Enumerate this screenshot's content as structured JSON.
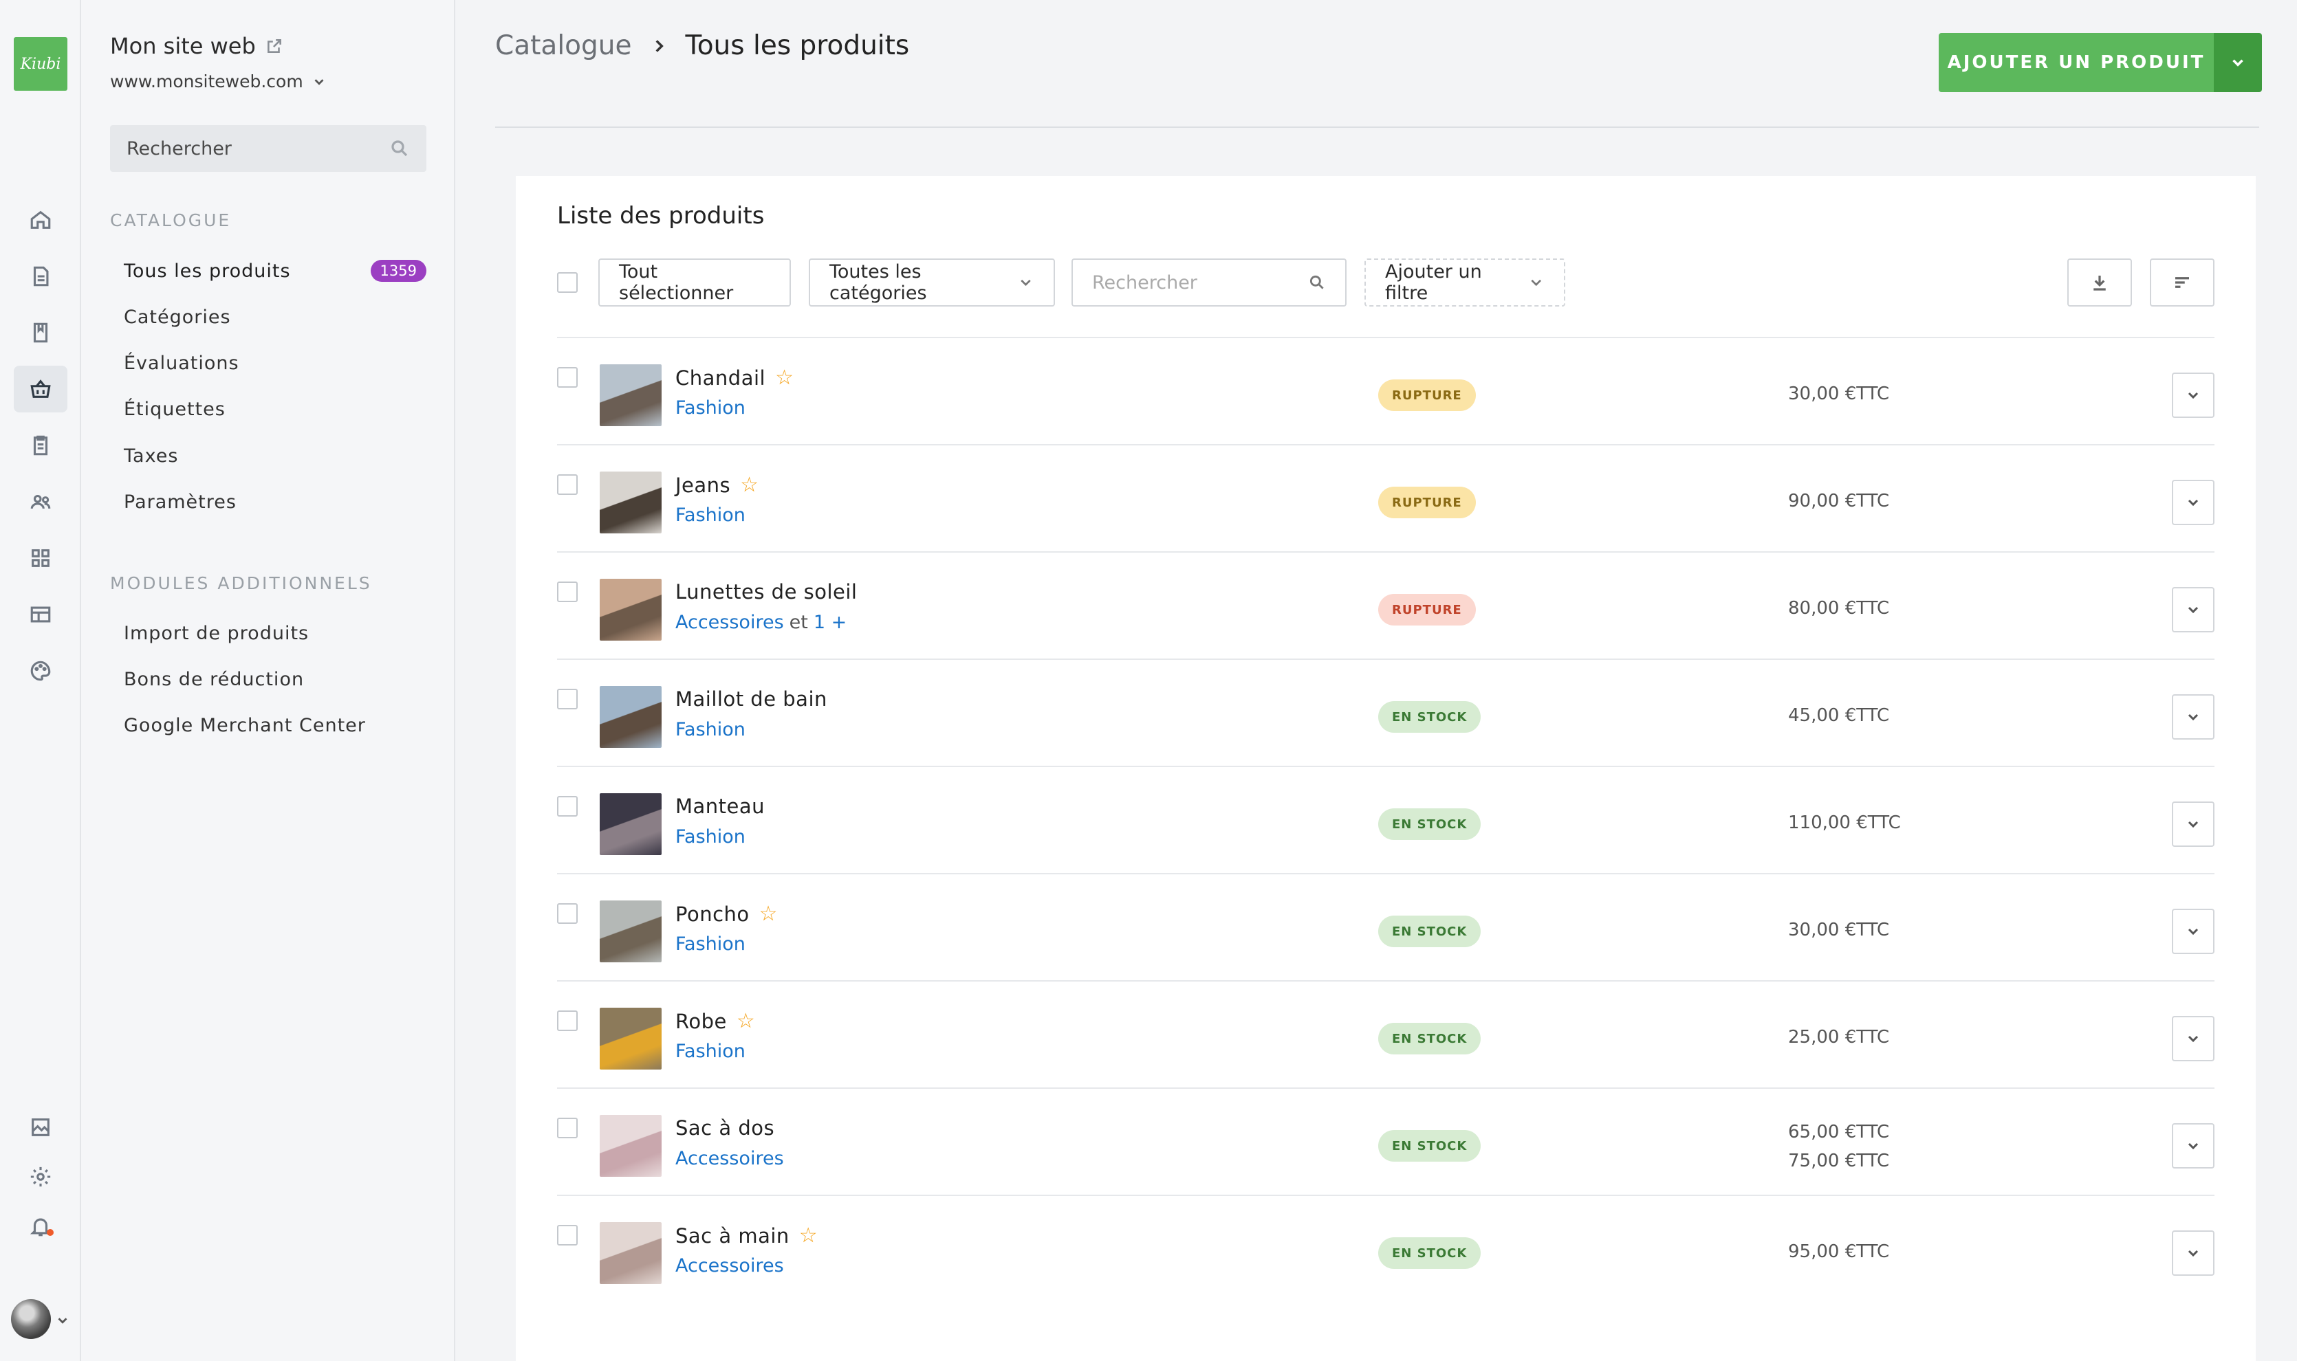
{
  "app": {
    "logo_text": "Kiubi",
    "site_name": "Mon site web",
    "site_url": "www.monsiteweb.com"
  },
  "rail_icons": [
    "home-icon",
    "page-icon",
    "blog-icon",
    "basket-icon",
    "orders-icon",
    "users-icon",
    "modules-icon",
    "layout-icon",
    "palette-icon",
    "media-icon",
    "gear-icon",
    "bell-icon"
  ],
  "sidebar": {
    "search_placeholder": "Rechercher",
    "catalogue_title": "CATALOGUE",
    "catalogue_items": [
      {
        "label": "Tous les produits",
        "badge": "1359"
      },
      {
        "label": "Catégories"
      },
      {
        "label": "Évaluations"
      },
      {
        "label": "Étiquettes"
      },
      {
        "label": "Taxes"
      },
      {
        "label": "Paramètres"
      }
    ],
    "modules_title": "MODULES ADDITIONNELS",
    "modules_items": [
      {
        "label": "Import de produits"
      },
      {
        "label": "Bons de réduction"
      },
      {
        "label": "Google Merchant Center"
      }
    ]
  },
  "header": {
    "breadcrumb_parent": "Catalogue",
    "breadcrumb_current": "Tous les produits",
    "add_button": "AJOUTER UN PRODUIT"
  },
  "list": {
    "title": "Liste des produits",
    "select_all": "Tout sélectionner",
    "category_filter": "Toutes les catégories",
    "search_placeholder": "Rechercher",
    "add_filter": "Ajouter un filtre"
  },
  "colors": {
    "accent_green": "#5cb85c",
    "badge_purple": "#9b3fc2",
    "link_blue": "#1a73c9",
    "star": "#f5a623"
  },
  "products": [
    {
      "name": "Chandail",
      "star": true,
      "category": "Fashion",
      "extra": "",
      "status": "RUPTURE",
      "status_type": "rupture",
      "prices": [
        "30,00 €TTC"
      ]
    },
    {
      "name": "Jeans",
      "star": true,
      "category": "Fashion",
      "extra": "",
      "status": "RUPTURE",
      "status_type": "rupture",
      "prices": [
        "90,00 €TTC"
      ]
    },
    {
      "name": "Lunettes de soleil",
      "star": false,
      "category": "Accessoires",
      "extra_et": "et",
      "extra": "1 +",
      "status": "RUPTURE",
      "status_type": "rupture-red",
      "prices": [
        "80,00 €TTC"
      ]
    },
    {
      "name": "Maillot de bain",
      "star": false,
      "category": "Fashion",
      "extra": "",
      "status": "EN STOCK",
      "status_type": "stock",
      "prices": [
        "45,00 €TTC"
      ]
    },
    {
      "name": "Manteau",
      "star": false,
      "category": "Fashion",
      "extra": "",
      "status": "EN STOCK",
      "status_type": "stock",
      "prices": [
        "110,00 €TTC"
      ]
    },
    {
      "name": "Poncho",
      "star": true,
      "category": "Fashion",
      "extra": "",
      "status": "EN STOCK",
      "status_type": "stock",
      "prices": [
        "30,00 €TTC"
      ]
    },
    {
      "name": "Robe",
      "star": true,
      "category": "Fashion",
      "extra": "",
      "status": "EN STOCK",
      "status_type": "stock",
      "prices": [
        "25,00 €TTC"
      ]
    },
    {
      "name": "Sac à dos",
      "star": false,
      "category": "Accessoires",
      "extra": "",
      "status": "EN STOCK",
      "status_type": "stock",
      "prices": [
        "65,00 €TTC",
        "75,00 €TTC"
      ]
    },
    {
      "name": "Sac à main",
      "star": true,
      "category": "Accessoires",
      "extra": "",
      "status": "EN STOCK",
      "status_type": "stock",
      "prices": [
        "95,00 €TTC"
      ]
    }
  ]
}
